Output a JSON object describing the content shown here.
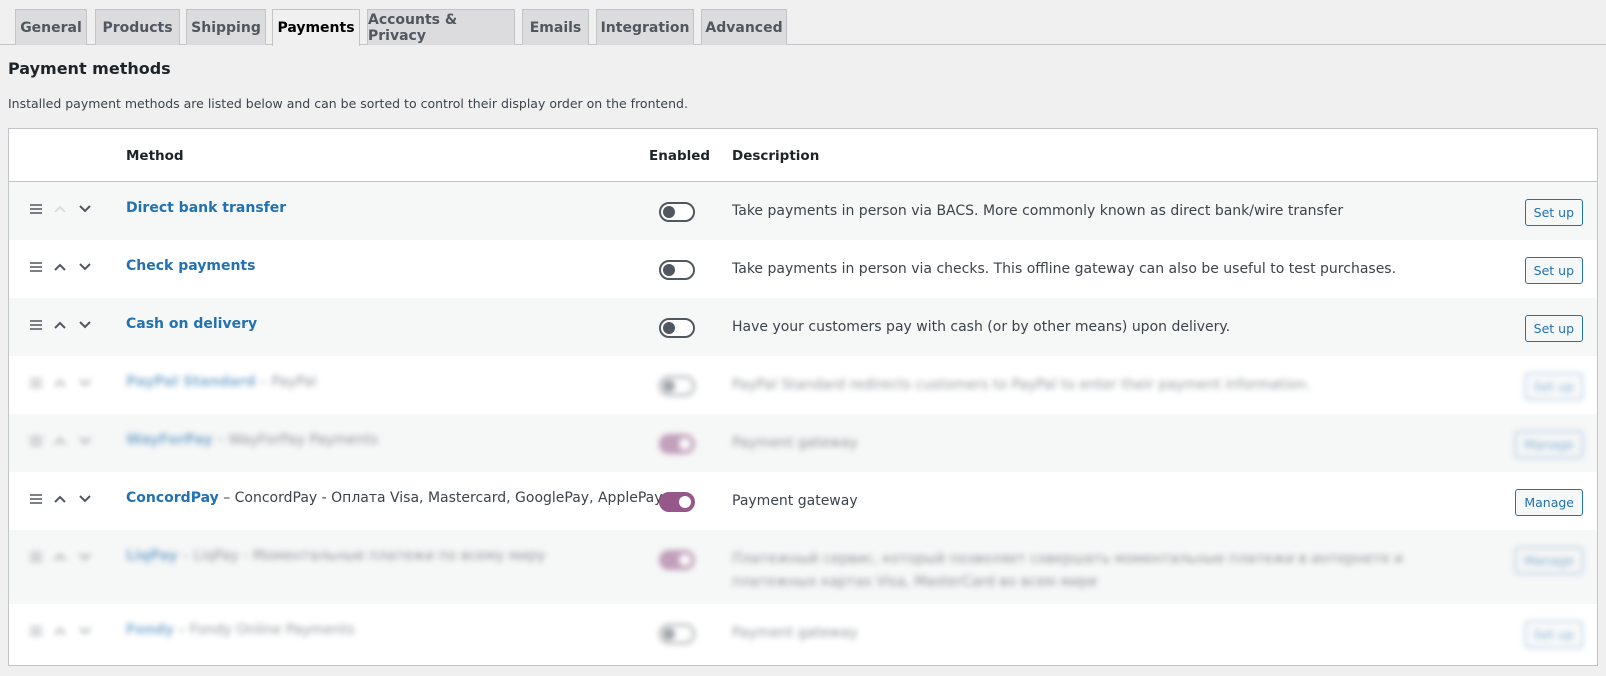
{
  "tabs": [
    "General",
    "Products",
    "Shipping",
    "Payments",
    "Accounts & Privacy",
    "Emails",
    "Integration",
    "Advanced"
  ],
  "active_tab": "Payments",
  "page": {
    "title": "Payment methods",
    "intro": "Installed payment methods are listed below and can be sorted to control their display order on the frontend."
  },
  "table": {
    "headers": {
      "method": "Method",
      "enabled": "Enabled",
      "description": "Description"
    },
    "rows": [
      {
        "name": "Direct bank transfer",
        "sub": "",
        "enabled": false,
        "description": "Take payments in person via BACS. More commonly known as direct bank/wire transfer",
        "action": "Set up",
        "blurred": false
      },
      {
        "name": "Check payments",
        "sub": "",
        "enabled": false,
        "description": "Take payments in person via checks. This offline gateway can also be useful to test purchases.",
        "action": "Set up",
        "blurred": false
      },
      {
        "name": "Cash on delivery",
        "sub": "",
        "enabled": false,
        "description": "Have your customers pay with cash (or by other means) upon delivery.",
        "action": "Set up",
        "blurred": false
      },
      {
        "name": "PayPal Standard",
        "sub": "– PayPal",
        "enabled": false,
        "description": "PayPal Standard redirects customers to PayPal to enter their payment information.",
        "action": "Set up",
        "blurred": true
      },
      {
        "name": "WayForPay",
        "sub": "– WayForPay Payments",
        "enabled": true,
        "description": "Payment gateway",
        "action": "Manage",
        "blurred": true
      },
      {
        "name": "ConcordPay",
        "sub": "– ConcordPay - Оплата Visa, Mastercard, GooglePay, ApplePay",
        "enabled": true,
        "description": "Payment gateway",
        "action": "Manage",
        "blurred": false
      },
      {
        "name": "LiqPay",
        "sub": "– LiqPay - Моментальные платежи по всему миру",
        "enabled": true,
        "description": "Платежный сервис, который позволяет совершать моментальные платежи в интернете и платежных картах Visa, MasterCard во всем мире",
        "action": "Manage",
        "blurred": true
      },
      {
        "name": "Fondy",
        "sub": "– Fondy Online Payments",
        "enabled": false,
        "description": "Payment gateway",
        "action": "Set up",
        "blurred": true
      }
    ]
  },
  "colors": {
    "link": "#2271b1",
    "toggle_on": "#96588a",
    "background": "#f0f0f1"
  },
  "icons": {
    "drag": "menu-icon",
    "up": "chevron-up-icon",
    "down": "chevron-down-icon"
  }
}
